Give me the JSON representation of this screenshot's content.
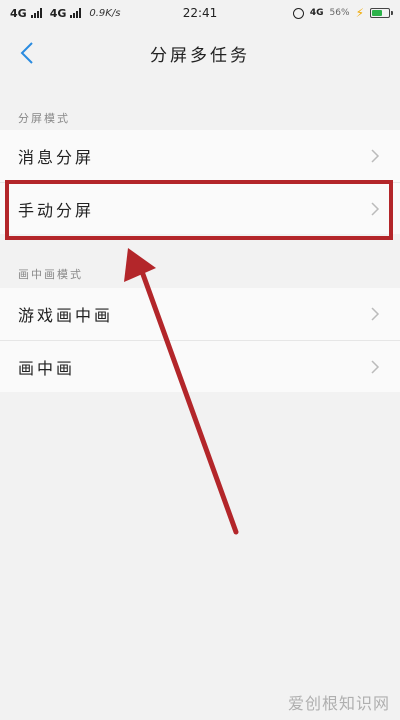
{
  "status_bar": {
    "network_1": "4G",
    "network_2": "4G",
    "speed": "0.9K/s",
    "time": "22:41",
    "network_3": "4G",
    "battery_percent": "56%",
    "battery_level": 0.65
  },
  "header": {
    "title": "分屏多任务"
  },
  "sections": [
    {
      "label": "分屏模式",
      "items": [
        {
          "label": "消息分屏"
        },
        {
          "label": "手动分屏"
        }
      ]
    },
    {
      "label": "画中画模式",
      "items": [
        {
          "label": "游戏画中画"
        },
        {
          "label": "画中画"
        }
      ]
    }
  ],
  "annotation": {
    "highlight_color": "#b3262a"
  },
  "watermark": "爱创根知识网"
}
